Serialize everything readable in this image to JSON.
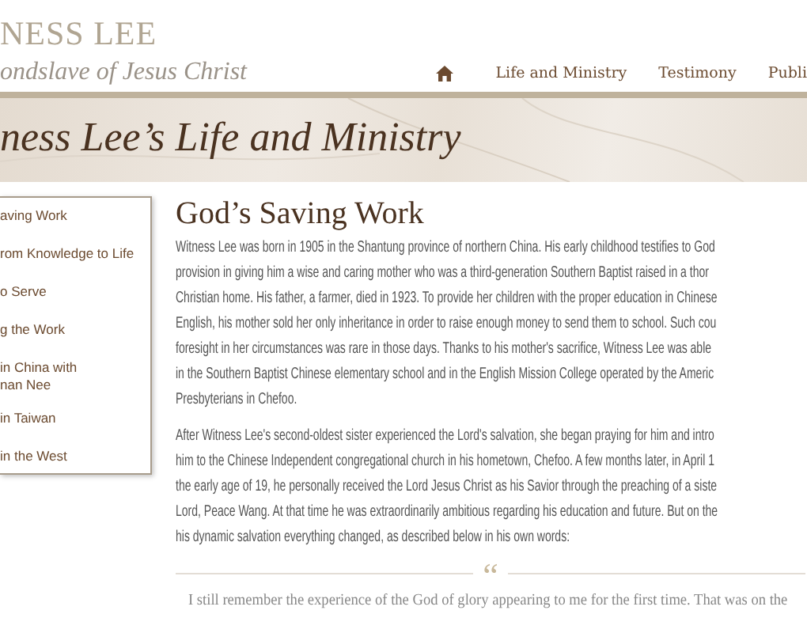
{
  "header": {
    "site_name": "NESS LEE",
    "tagline": "ondslave of Jesus Christ"
  },
  "nav": [
    {
      "kind": "home"
    },
    {
      "kind": "link",
      "label": "Life and Ministry"
    },
    {
      "kind": "link",
      "label": "Testimony"
    },
    {
      "kind": "link",
      "label": "Publi"
    }
  ],
  "banner": {
    "title": "ness Lee’s Life and Ministry"
  },
  "sidebar": {
    "items": [
      {
        "lines": [
          "aving Work"
        ]
      },
      {
        "lines": [
          "rom Knowledge to Life"
        ]
      },
      {
        "lines": [
          "o Serve"
        ]
      },
      {
        "lines": [
          "g the Work"
        ]
      },
      {
        "lines": [
          "in China with",
          "nan Nee"
        ]
      },
      {
        "lines": [
          "in Taiwan"
        ]
      },
      {
        "lines": [
          "in the West"
        ]
      }
    ]
  },
  "article": {
    "heading": "God’s Saving Work",
    "paragraphs": [
      [
        "Witness Lee was born in 1905 in the Shantung province of northern China. His early childhood testifies to God",
        "provision in giving him a wise and caring mother who was a third-generation Southern Baptist raised in a thor",
        "Christian home. His father, a farmer, died in 1923. To provide her children with the proper education in Chinese",
        "English, his mother sold her only inheritance in order to raise enough money to send them to school. Such cou",
        "foresight in her circumstances was rare in those days. Thanks to his mother's sacrifice, Witness Lee was able",
        "in the Southern Baptist Chinese elementary school and in the English Mission College operated by the Americ",
        "Presbyterians in Chefoo."
      ],
      [
        "After Witness Lee's second-oldest sister experienced the Lord's salvation, she began praying for him and intro",
        "him to the Chinese Independent congregational church in his hometown, Chefoo. A few months later, in April 1",
        "the early age of 19, he personally received the Lord Jesus Christ as his Savior through the preaching of a siste",
        "Lord, Peace Wang. At that time he was extraordinarily ambitious regarding his education and future. But on the",
        "his dynamic salvation everything changed, as described below in his own words:"
      ]
    ],
    "quote_mark": "“",
    "quote": "I still remember the experience of the God of glory appearing to me for the first time. That was on the"
  }
}
